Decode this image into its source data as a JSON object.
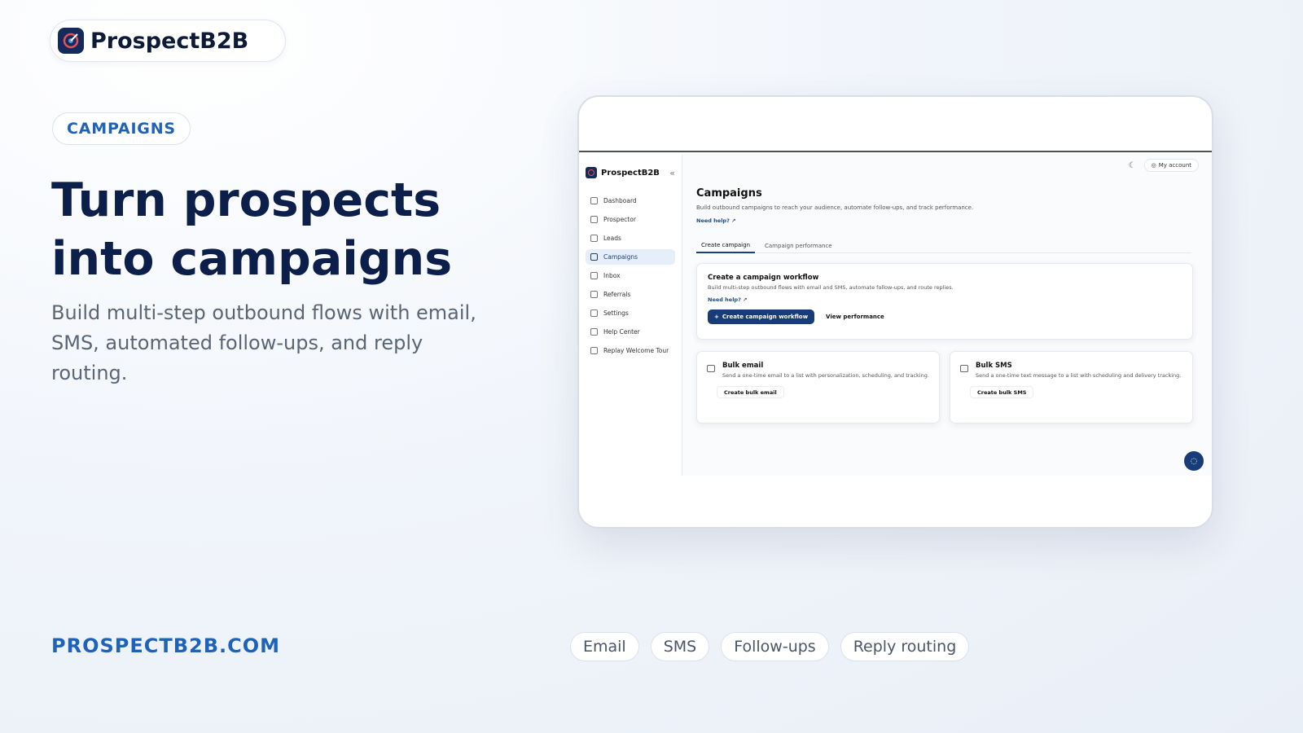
{
  "brand": {
    "name": "ProspectB2B",
    "logo_icon": "target-logo-icon"
  },
  "section_badge": "CAMPAIGNS",
  "hero": {
    "title_line1": "Turn prospects",
    "title_line2": "into campaigns",
    "subtitle": "Build multi-step outbound flows with email, SMS, automated follow-ups, and reply routing."
  },
  "site_url": "PROSPECTB2B.COM",
  "tags": [
    "Email",
    "SMS",
    "Follow-ups",
    "Reply routing"
  ],
  "app": {
    "brand": "ProspectB2B",
    "collapse_glyph": "«",
    "nav": [
      {
        "label": "Dashboard",
        "icon": "home-icon"
      },
      {
        "label": "Prospector",
        "icon": "layers-icon"
      },
      {
        "label": "Leads",
        "icon": "users-icon"
      },
      {
        "label": "Campaigns",
        "icon": "mail-icon",
        "active": true
      },
      {
        "label": "Inbox",
        "icon": "inbox-icon"
      },
      {
        "label": "Referrals",
        "icon": "gift-icon"
      },
      {
        "label": "Settings",
        "icon": "gear-icon"
      },
      {
        "label": "Help Center",
        "icon": "help-icon"
      },
      {
        "label": "Replay Welcome Tour",
        "icon": "replay-icon"
      }
    ],
    "header": {
      "account_label": "My account"
    },
    "page": {
      "title": "Campaigns",
      "description": "Build outbound campaigns to reach your audience, automate follow-ups, and track performance.",
      "help_link": "Need help? ↗"
    },
    "tabs": [
      "Create campaign",
      "Campaign performance"
    ],
    "workflow_card": {
      "title": "Create a campaign workflow",
      "description": "Build multi-step outbound flows with email and SMS, automate follow-ups, and route replies.",
      "help_link": "Need help? ↗",
      "primary_button": "Create campaign workflow",
      "secondary_button": "View performance"
    },
    "bulk_email": {
      "title": "Bulk email",
      "description": "Send a one-time email to a list with personalization, scheduling, and tracking.",
      "button": "Create bulk email"
    },
    "bulk_sms": {
      "title": "Bulk SMS",
      "description": "Send a one-time text message to a list with scheduling and delivery tracking.",
      "button": "Create bulk SMS"
    }
  },
  "colors": {
    "accent": "#1f63b8",
    "navy": "#0c1f4a",
    "primary_button": "#173c78"
  }
}
